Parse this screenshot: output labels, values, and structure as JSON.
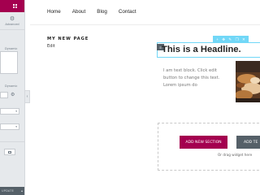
{
  "panel": {
    "advanced_label": "Advanced",
    "icons": {
      "menu": "grid-menu-icon",
      "advanced": "gear-icon"
    },
    "labels": {
      "label_1": "Dynamic",
      "label_2": "Dynamic"
    },
    "footer": {
      "update_label": "UPDATE",
      "caret": "caret-up-icon"
    },
    "accent_color": "#a4004f"
  },
  "nav": {
    "items": [
      "Home",
      "About",
      "Blog",
      "Contact"
    ]
  },
  "page": {
    "title": "MY NEW PAGE",
    "edit_link": "Edit"
  },
  "headline": {
    "text": "This is a Headline."
  },
  "text_block": {
    "text": "I am text block. Click edit button to change this text. Lorem ipsum do"
  },
  "drop_zone": {
    "add_section": "ADD NEW SECTION",
    "add_template": "ADD TE",
    "hint": "Or drag widget here"
  }
}
